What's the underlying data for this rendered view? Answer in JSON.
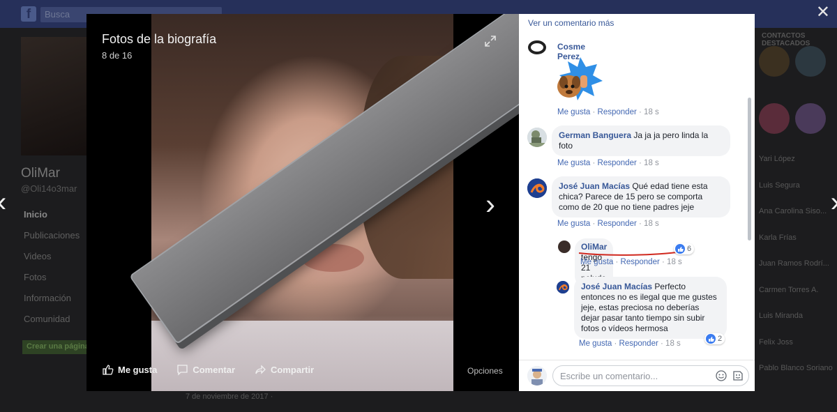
{
  "background": {
    "search_placeholder": "Busca",
    "profile_name": "OliMar",
    "profile_handle": "@Oli14o3mar",
    "nav_items": [
      "Inicio",
      "Publicaciones",
      "Videos",
      "Fotos",
      "Información",
      "Comunidad"
    ],
    "create_page_label": "Crear una página",
    "right_title": "CONTACTOS DESTACADOS",
    "contacts": [
      "Yari López",
      "Luis Segura",
      "Ana Carolina Siso...",
      "Karla Frías",
      "Juan Ramos Rodrí...",
      "Carmen Torres A.",
      "Luis Miranda",
      "Felix Joss",
      "Pablo Blanco Soriano"
    ],
    "post_date": "7 de noviembre de 2017 · "
  },
  "viewer": {
    "title": "Fotos de la biografía",
    "count": "8 de 16",
    "actions": {
      "like": "Me gusta",
      "comment": "Comentar",
      "share": "Compartir"
    },
    "options": "Opciones"
  },
  "comments": {
    "more_link": "Ver un comentario más",
    "items": [
      {
        "name": "Cosme Perez",
        "text": "",
        "like": "Me gusta",
        "reply": "Responder",
        "time": "18 s"
      },
      {
        "name": "German Banguera",
        "text": "Ja ja ja pero linda la foto",
        "like": "Me gusta",
        "reply": "Responder",
        "time": "18 s"
      },
      {
        "name": "José Juan Macías",
        "text": "Qué edad tiene esta chica? Parece de 15 pero se comporta como de 20 que no tiene padres jeje",
        "like": "Me gusta",
        "reply": "Responder",
        "time": "18 s"
      },
      {
        "name": "OliMar",
        "text": "tengo 21 peludo",
        "reactions": "6",
        "like": "Me gusta",
        "reply": "Responder",
        "time": "18 s"
      },
      {
        "name": "José Juan Macías",
        "text": "Perfecto entonces no es ilegal que me gustes jeje, estas preciosa no deberías dejar pasar tanto tiempo sin subir fotos o vídeos hermosa",
        "reactions": "2",
        "like": "Me gusta",
        "reply": "Responder",
        "time": "18 s"
      }
    ],
    "composer_placeholder": "Escribe un comentario..."
  },
  "colors": {
    "link_blue": "#385898",
    "like_blue": "#3b7cf0",
    "underline_red": "#d0281e"
  }
}
